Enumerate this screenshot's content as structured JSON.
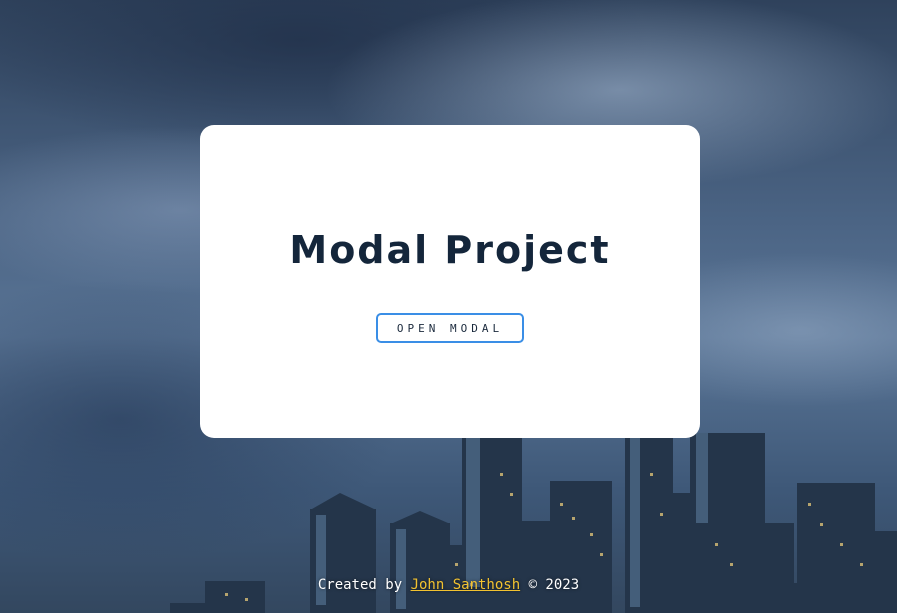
{
  "modal": {
    "title": "Modal Project",
    "open_button_label": "OPEN MODAL"
  },
  "footer": {
    "prefix": "Created by ",
    "author": "John Santhosh",
    "suffix": " © 2023"
  },
  "colors": {
    "title": "#14263b",
    "button_border": "#3a8ee6",
    "link": "#f2c230"
  }
}
